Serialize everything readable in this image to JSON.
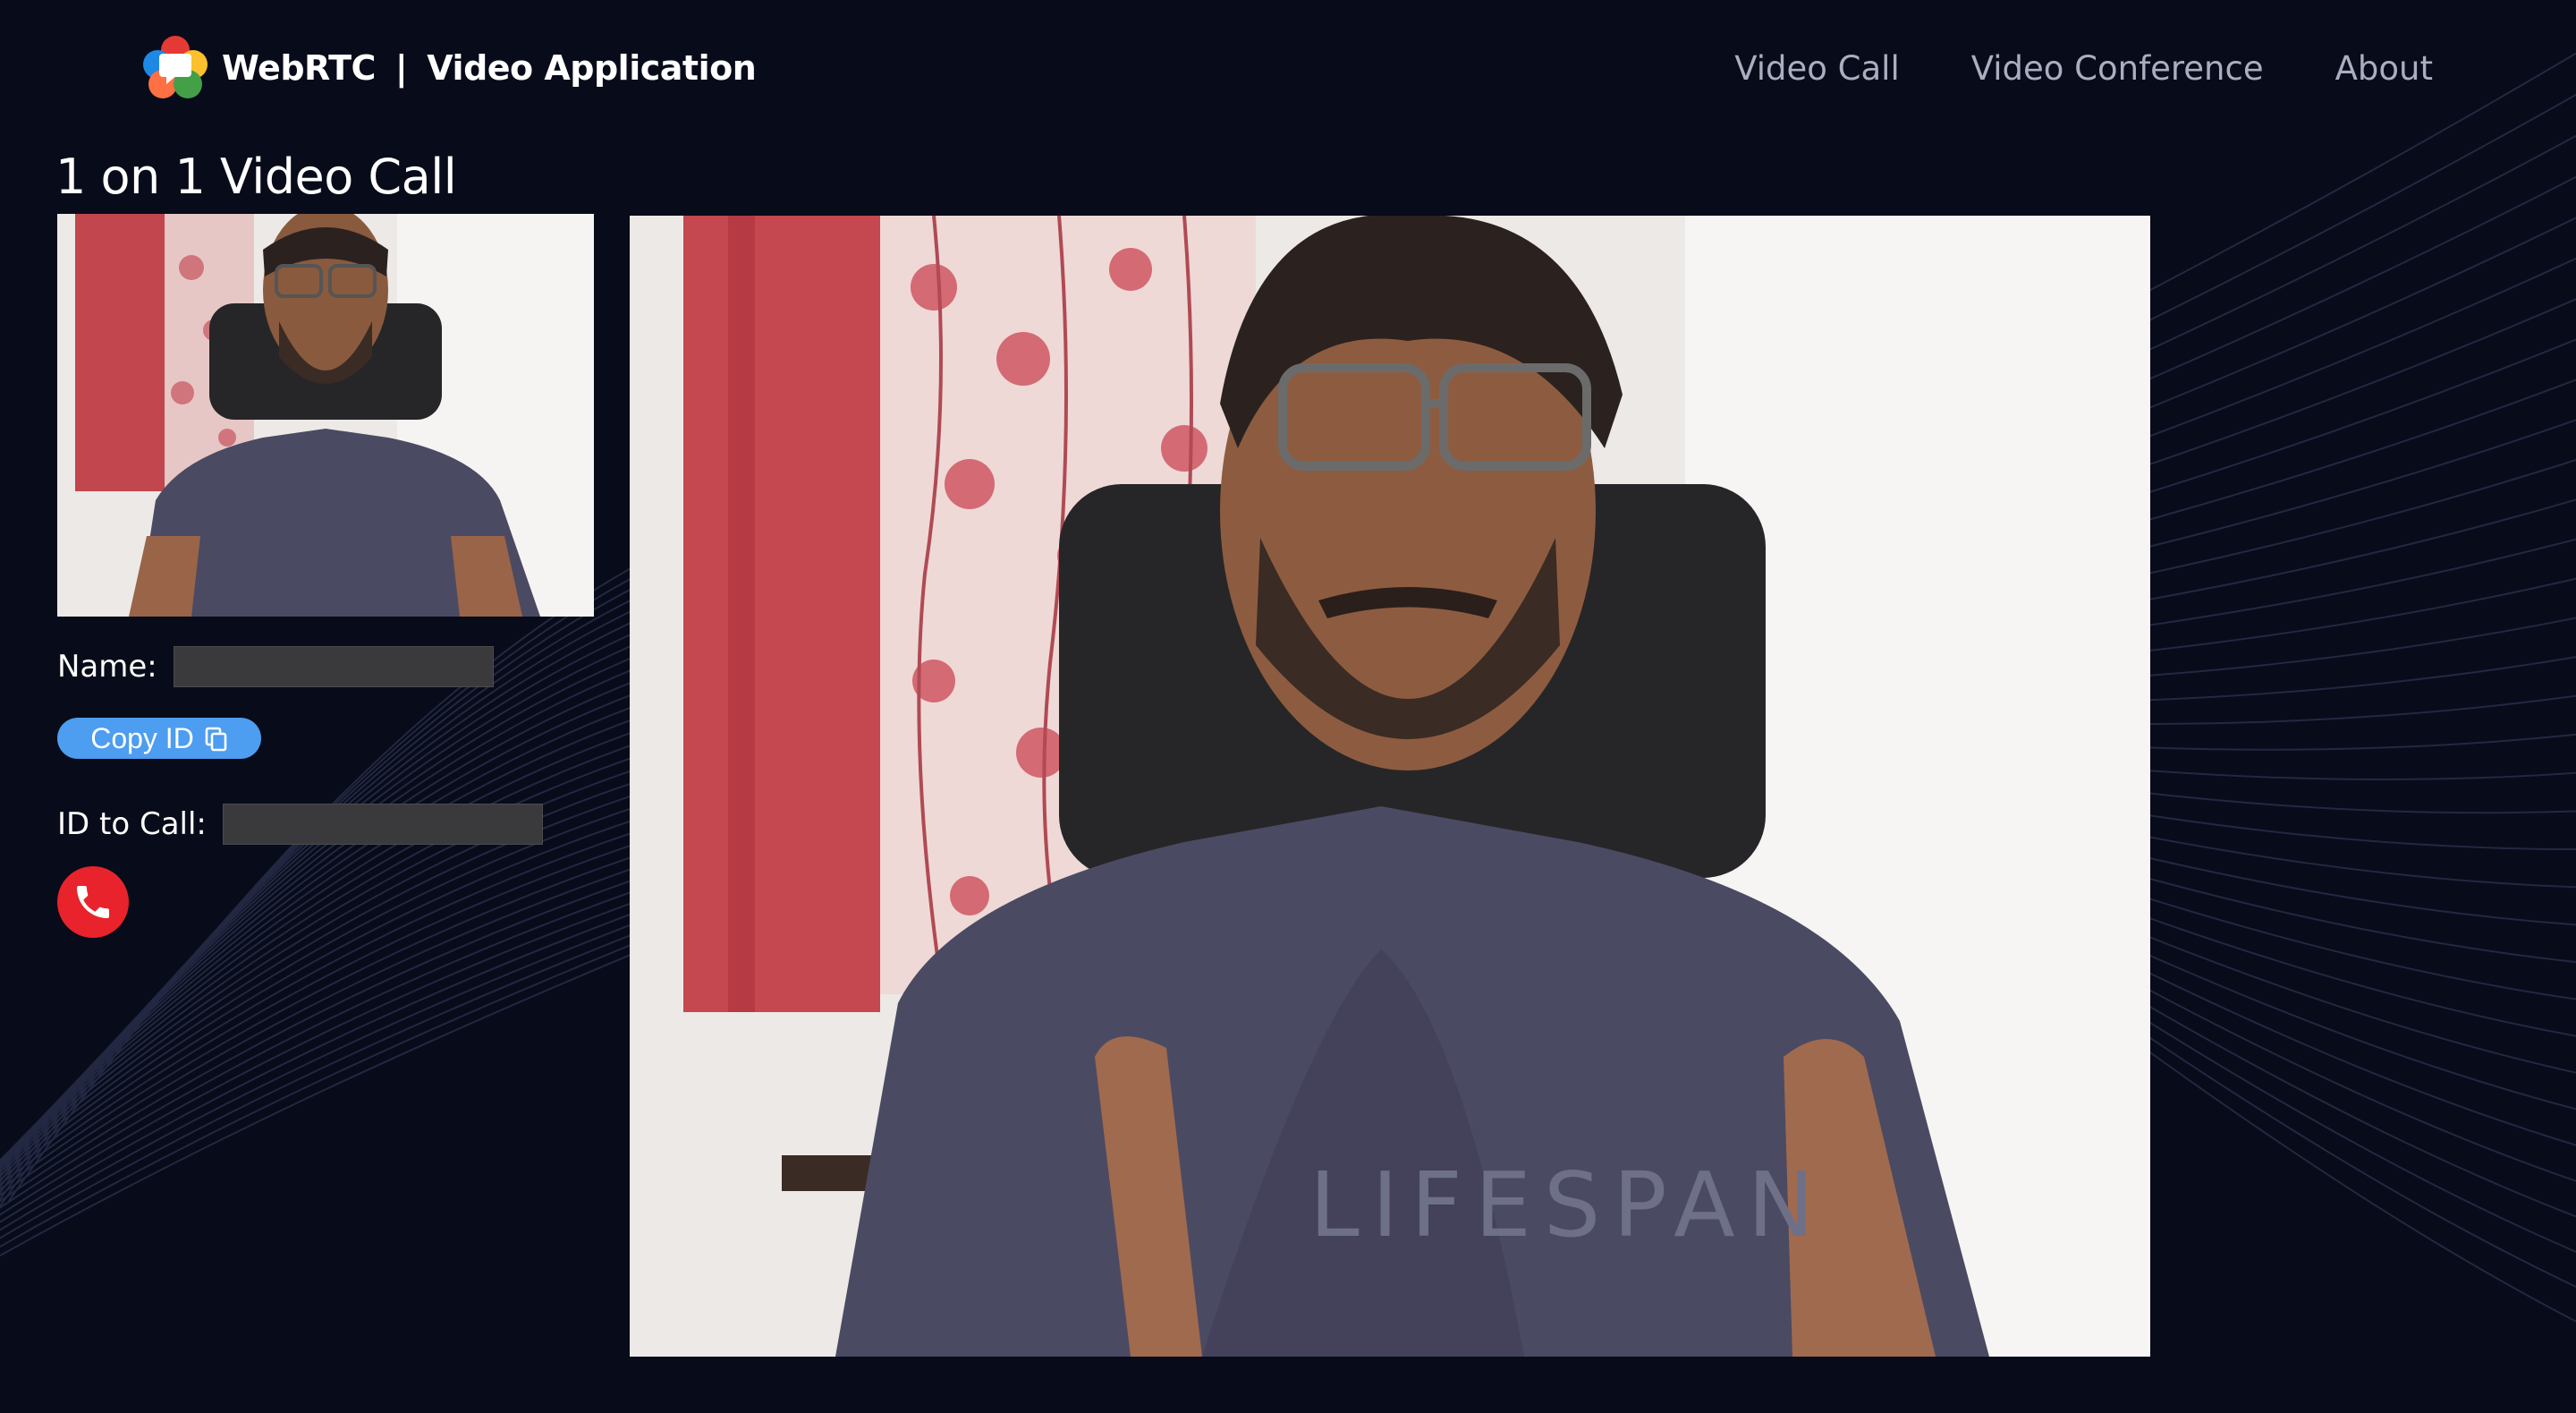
{
  "brand": {
    "name": "WebRTC",
    "separator": "|",
    "app": "Video Application",
    "logo_icon": "webrtc-logo-icon"
  },
  "nav": [
    {
      "label": "Video Call"
    },
    {
      "label": "Video Conference"
    },
    {
      "label": "About"
    }
  ],
  "page": {
    "title": "1 on 1 Video Call"
  },
  "form": {
    "name_label": "Name:",
    "name_value": "",
    "copy_button": "Copy ID",
    "copy_icon": "copy-icon",
    "id_label": "ID to Call:",
    "id_value": "",
    "call_icon": "phone-icon"
  },
  "colors": {
    "background": "#080b19",
    "copy_button": "#4d9df0",
    "call_button": "#e8232b",
    "input_bg": "#3a3a3c",
    "nav_text": "#a9aec0"
  }
}
